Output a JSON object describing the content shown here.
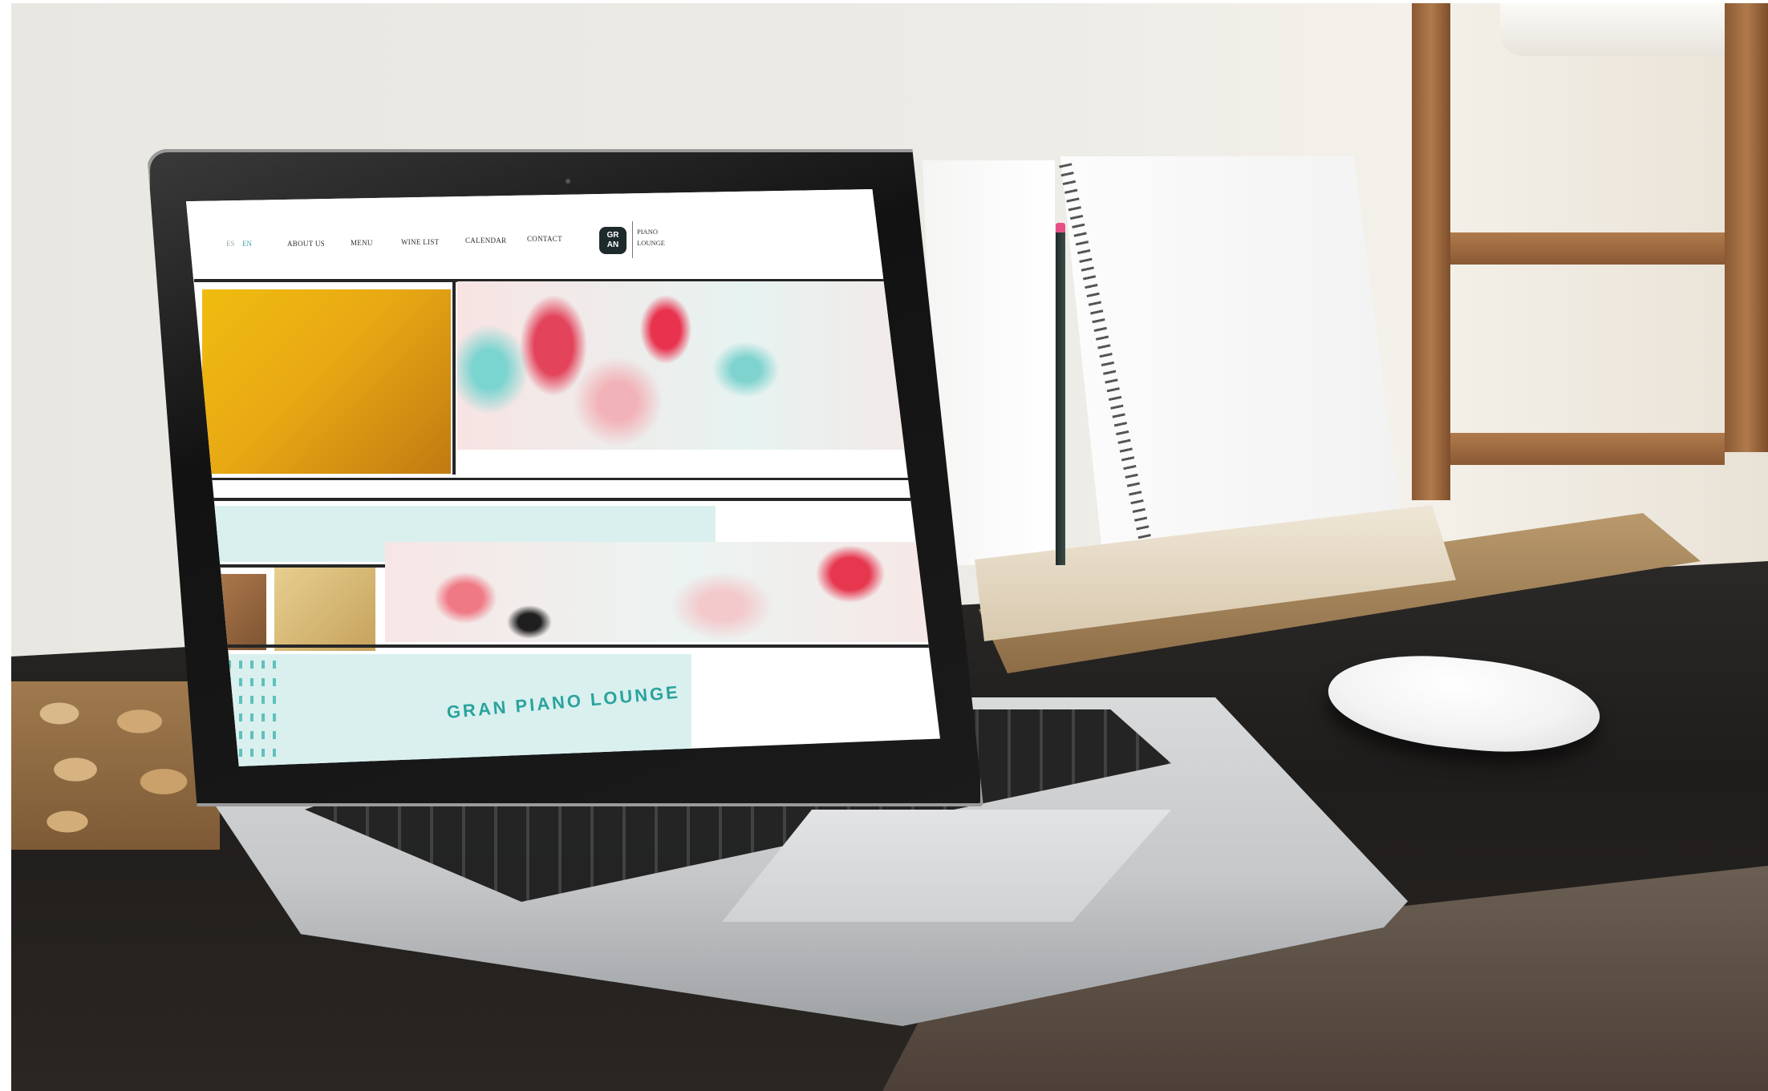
{
  "site": {
    "nav": {
      "lang_es": "ES",
      "lang_en": "EN",
      "links": [
        "ABOUT US",
        "MENU",
        "WINE LIST",
        "CALENDAR",
        "CONTACT"
      ]
    },
    "brand": {
      "badge_line1": "GR",
      "badge_line2": "AN",
      "name_line1": "PIANO",
      "name_line2": "LOUNGE"
    },
    "hero": {
      "title": "GRAN PIANO LOUNGE"
    }
  },
  "colors": {
    "accent": "#2aa39d",
    "mint": "#d9f0ef",
    "badge": "#1e2a2c",
    "yellow": "#f0bc10"
  },
  "icons": {
    "camera": "camera-icon"
  }
}
